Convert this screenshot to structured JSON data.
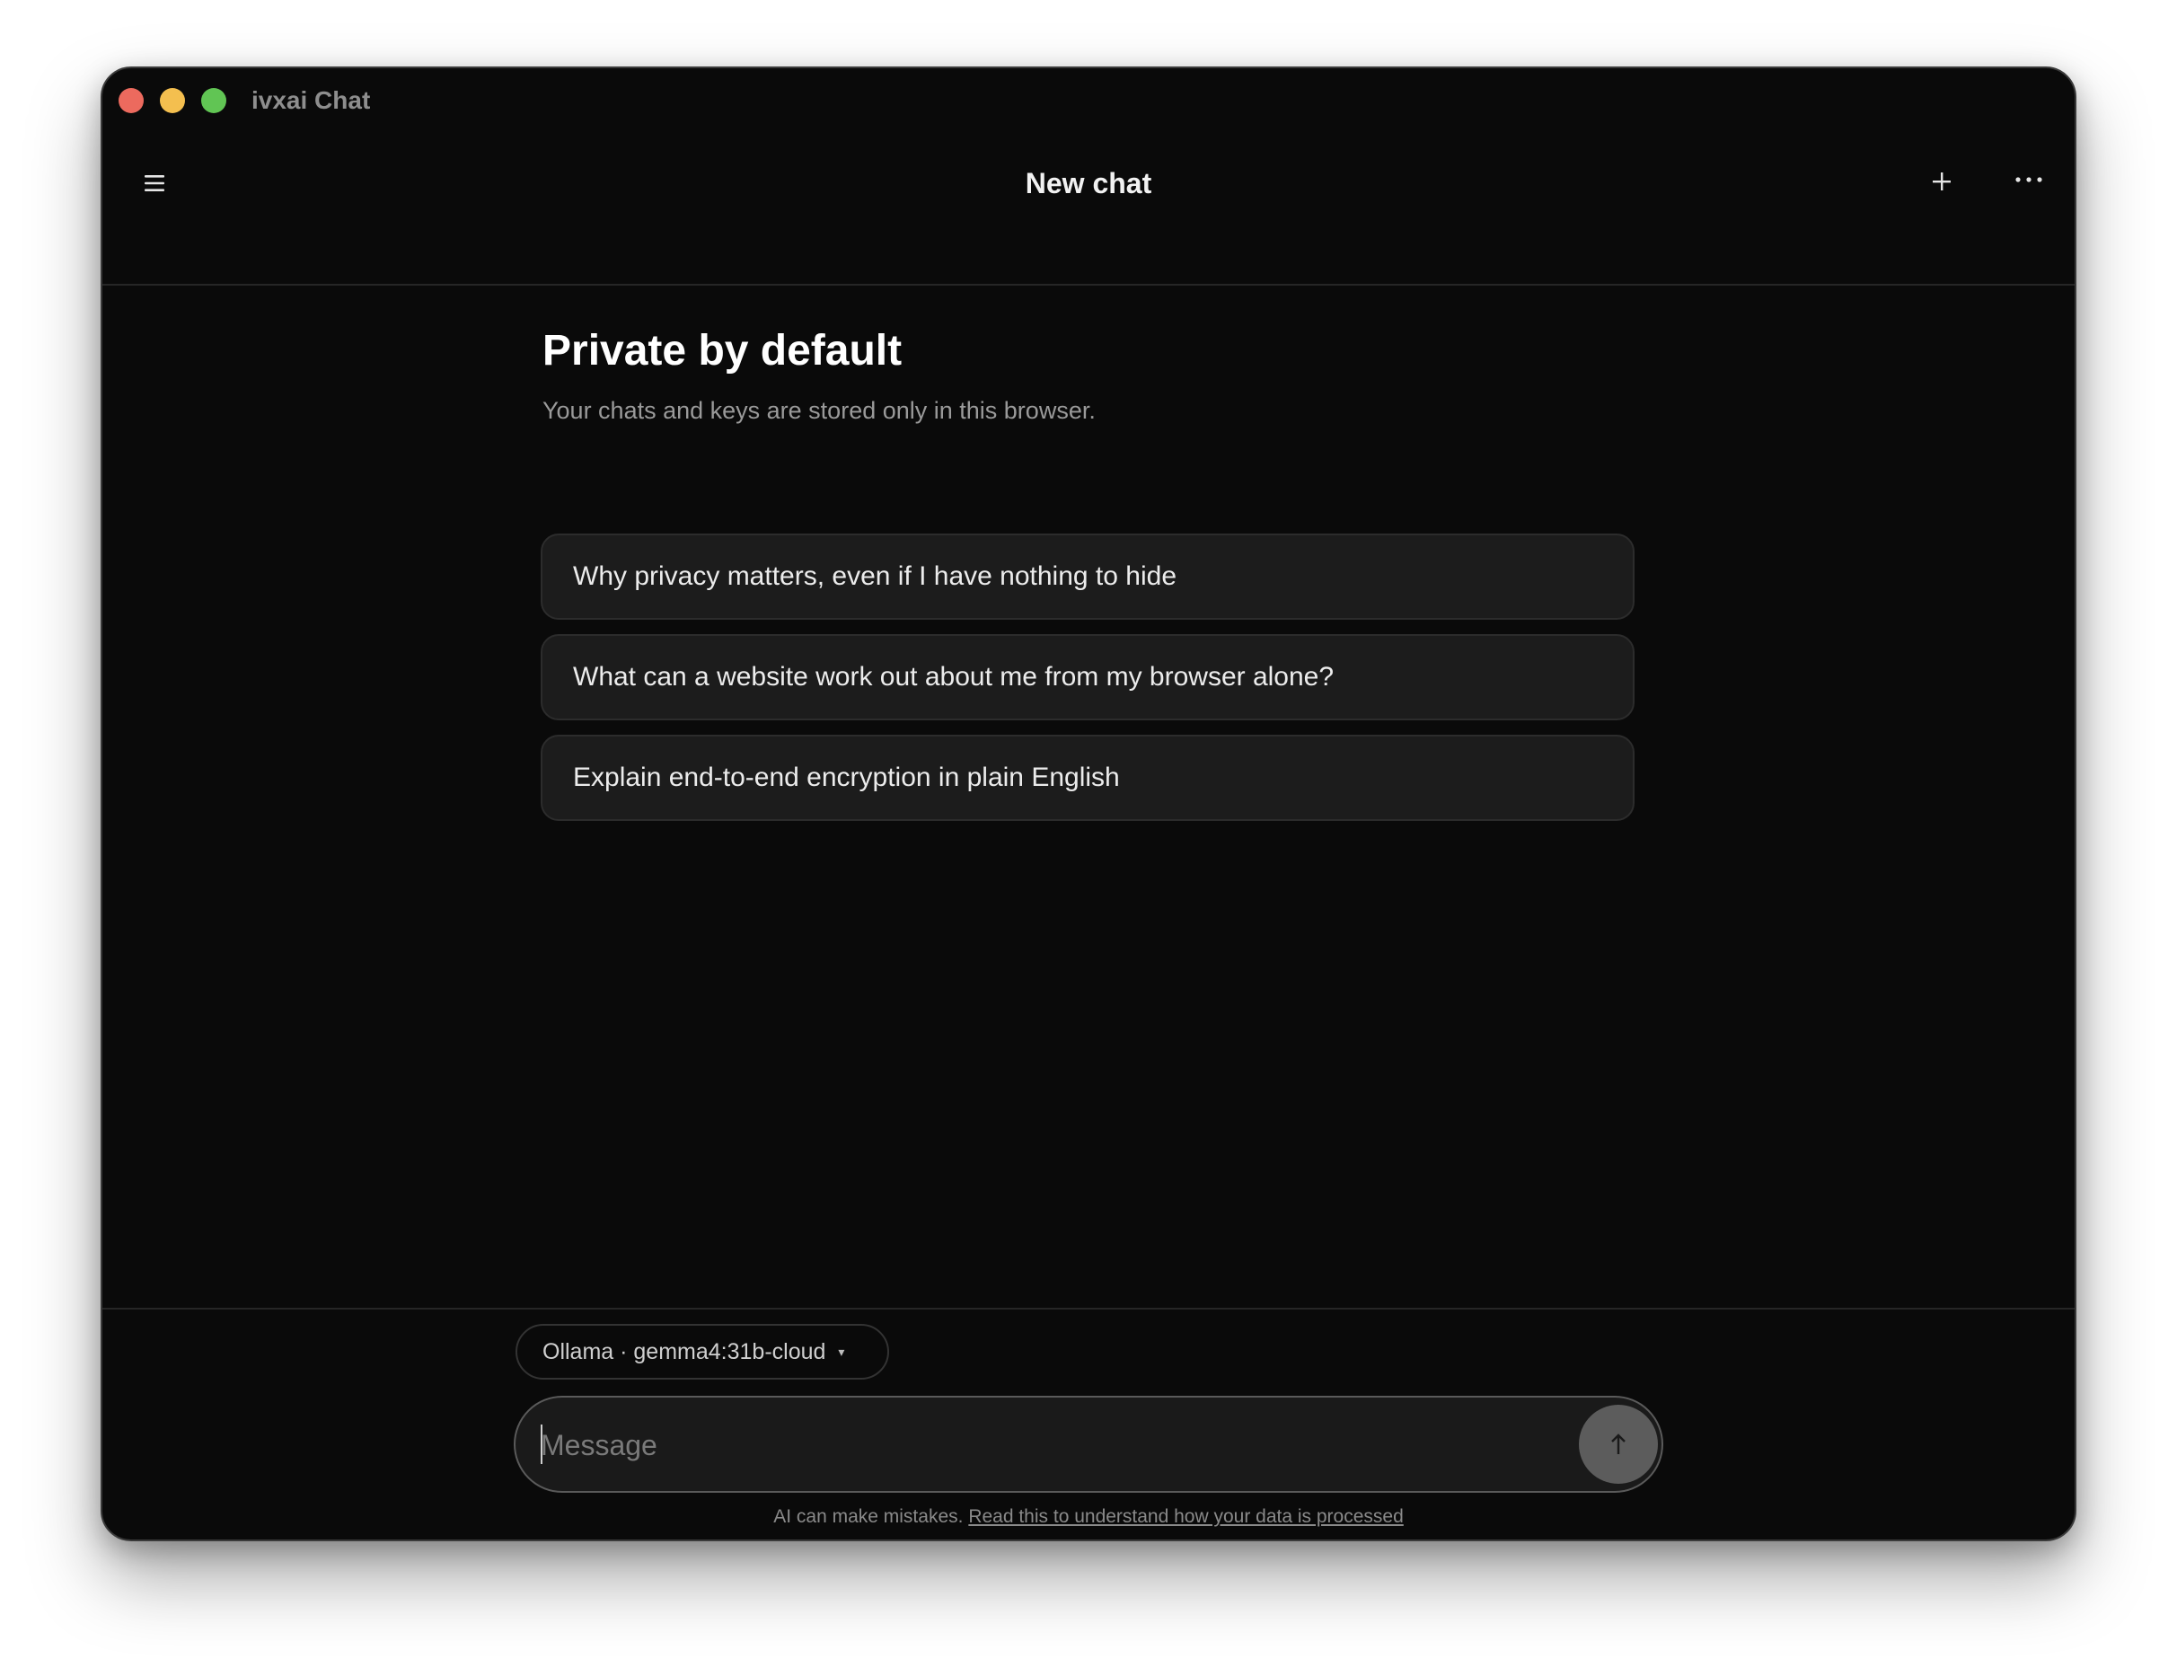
{
  "window": {
    "title": "ivxai Chat"
  },
  "header": {
    "title": "New chat",
    "menu_icon": "hamburger-menu-icon",
    "new_chat_icon": "plus-icon",
    "more_icon": "more-horizontal-icon"
  },
  "hero": {
    "title": "Private by default",
    "subtitle": "Your chats and keys are stored only in this browser."
  },
  "suggestions": [
    {
      "label": "Why privacy matters, even if I have nothing to hide"
    },
    {
      "label": "What can a website work out about me from my browser alone?"
    },
    {
      "label": "Explain end-to-end encryption in plain English"
    }
  ],
  "composer": {
    "model_label": "Ollama · gemma4:31b-cloud",
    "model_caret": "▾",
    "placeholder": "Message",
    "send_icon": "arrow-up-icon"
  },
  "footer": {
    "disclaimer_text": "AI can make mistakes.",
    "disclaimer_link": "Read this to understand how your data is processed"
  },
  "colors": {
    "background": "#0a0a0a",
    "card": "#1c1c1c",
    "traffic_red": "#ec6a5e",
    "traffic_yellow": "#f4bf4f",
    "traffic_green": "#61c554",
    "send_button": "#5c5c5c"
  }
}
